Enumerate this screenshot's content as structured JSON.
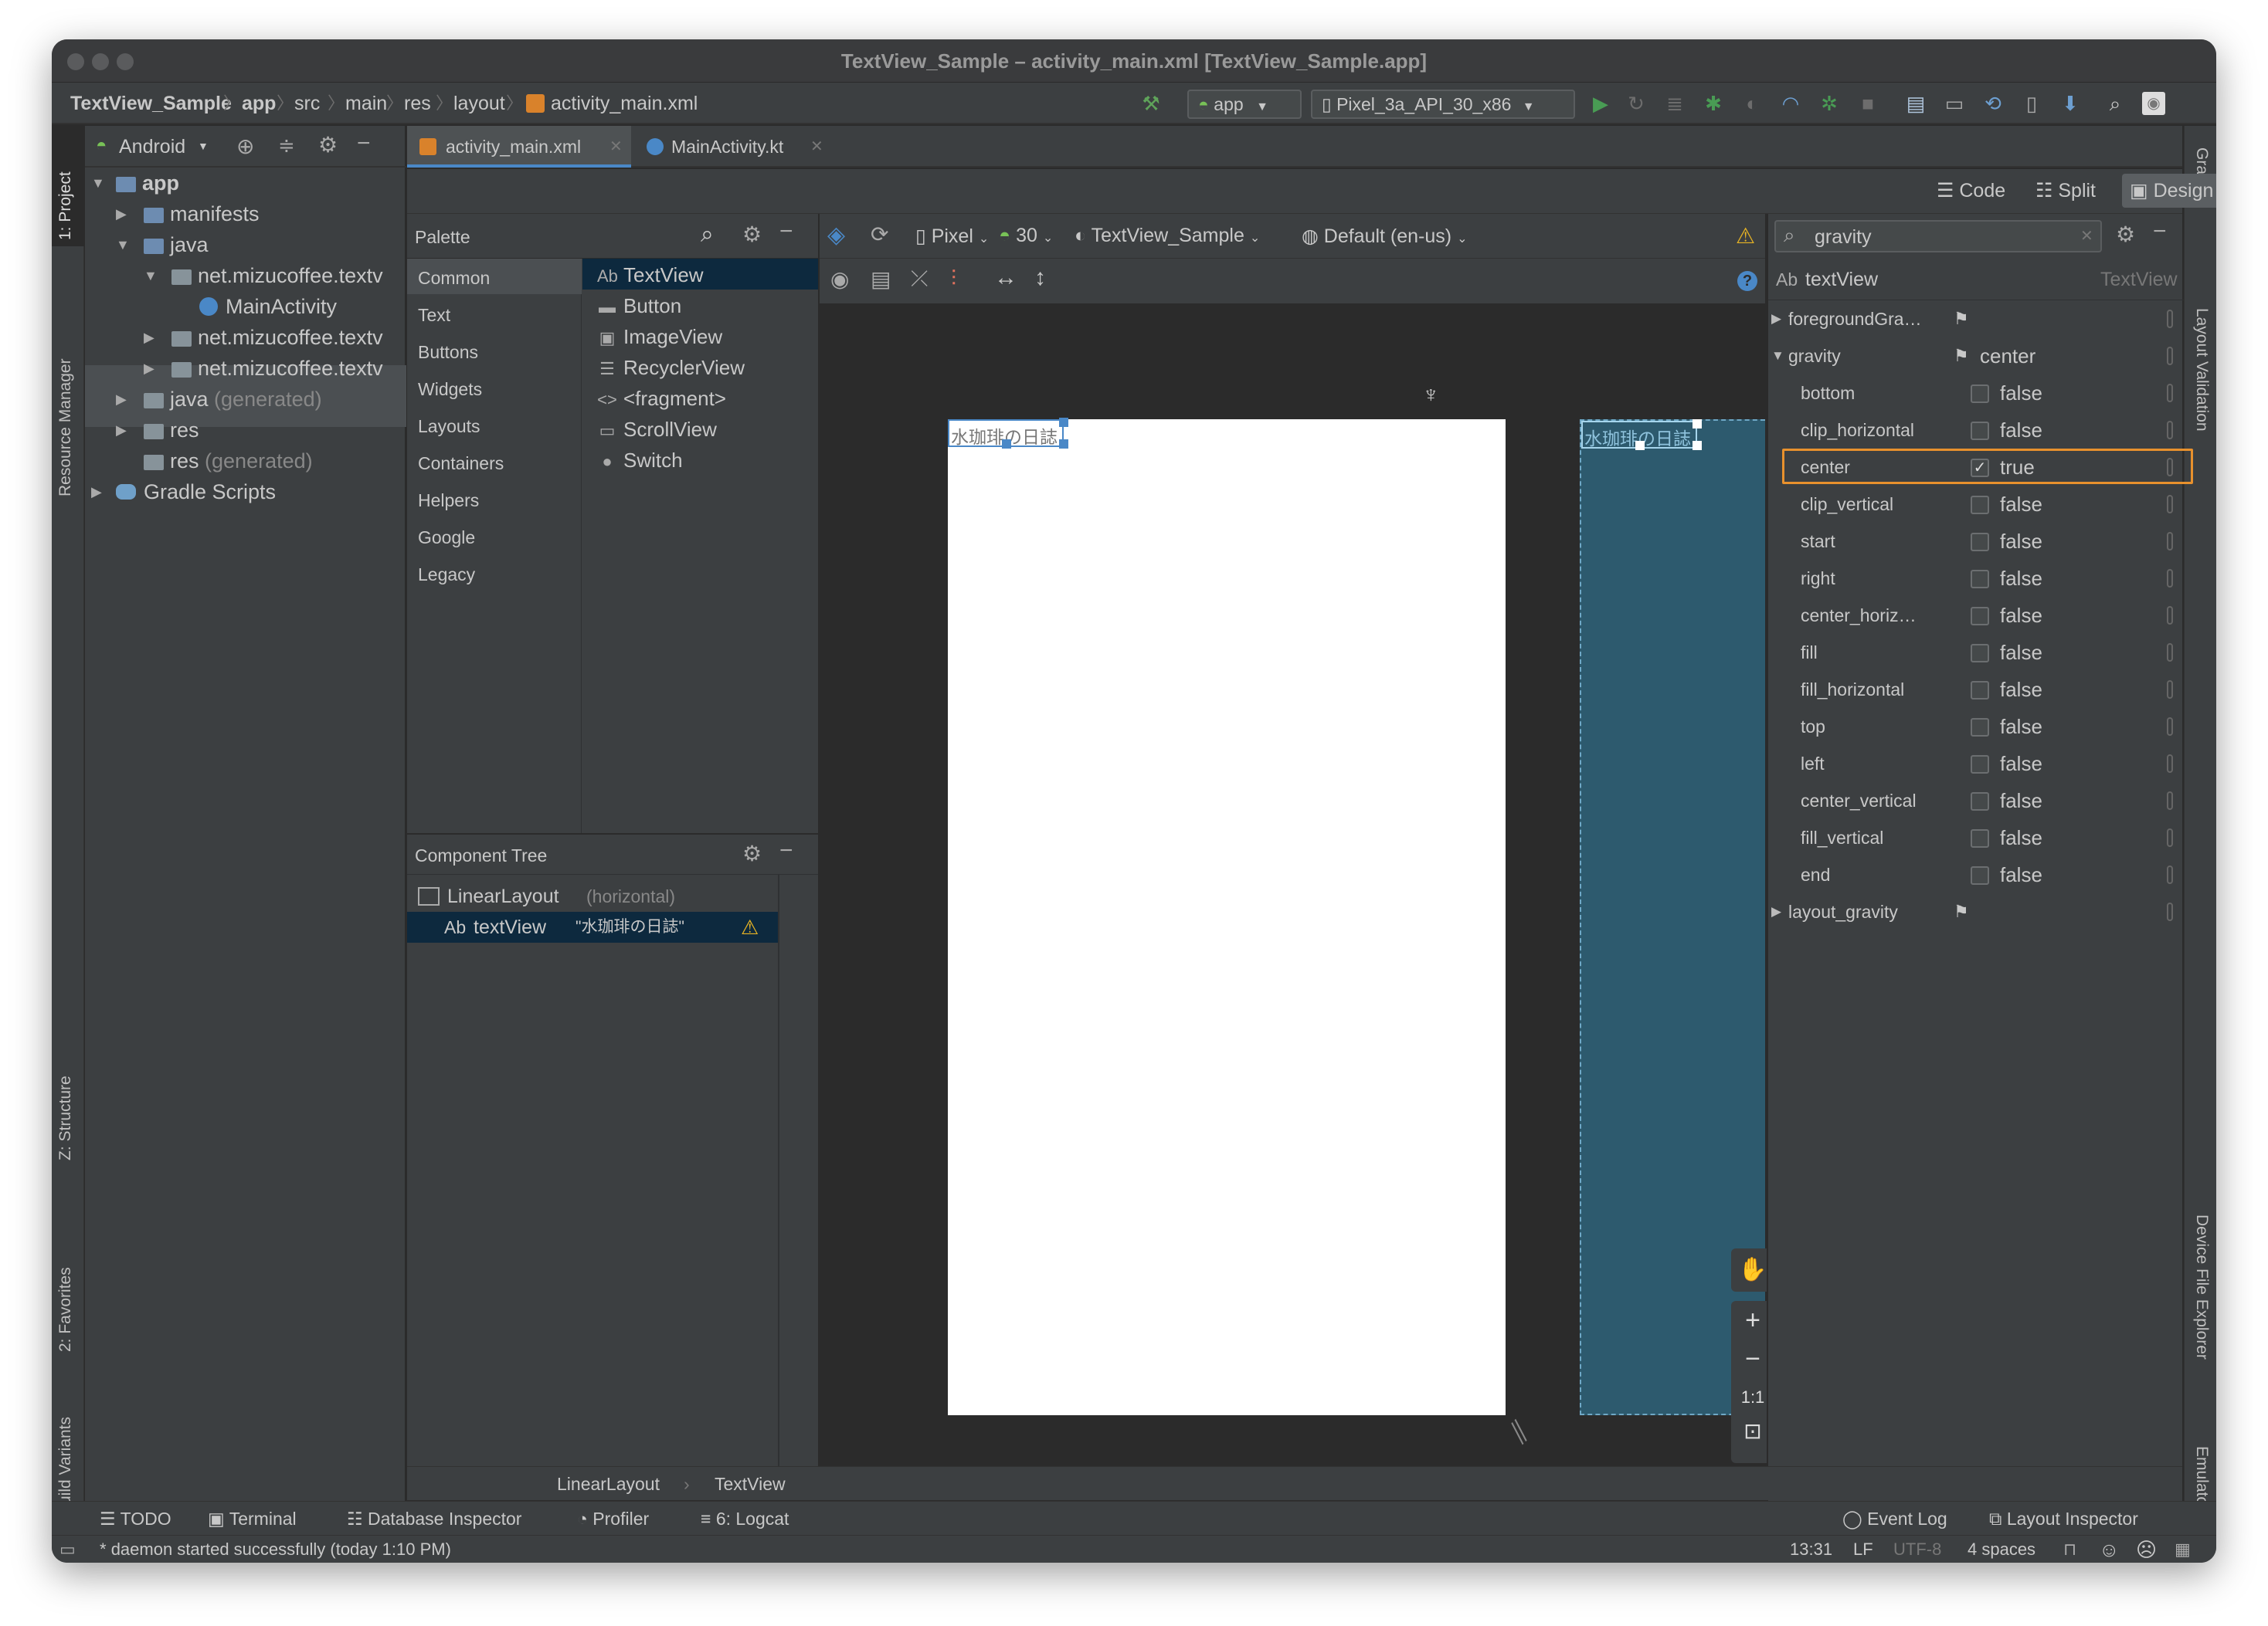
{
  "window": {
    "title": "TextView_Sample – activity_main.xml [TextView_Sample.app]"
  },
  "breadcrumb": [
    "TextView_Sample",
    "app",
    "src",
    "main",
    "res",
    "layout",
    "activity_main.xml"
  ],
  "run_config": "app",
  "device": "Pixel_3a_API_30_x86",
  "left_tools": {
    "project": "1: Project",
    "resource_manager": "Resource Manager",
    "structure": "Z: Structure",
    "favorites": "2: Favorites",
    "build_variants": "Build Variants"
  },
  "right_tools": {
    "gradle": "Gradle",
    "layout_validation": "Layout Validation",
    "device_file_explorer": "Device File Explorer",
    "emulator": "Emulator"
  },
  "project": {
    "view_mode": "Android",
    "tree": [
      {
        "label": "app",
        "bold": true
      },
      {
        "label": "manifests"
      },
      {
        "label": "java"
      },
      {
        "label": "net.mizucoffee.textv"
      },
      {
        "label": "MainActivity"
      },
      {
        "label": "net.mizucoffee.textv"
      },
      {
        "label": "net.mizucoffee.textv"
      },
      {
        "label": "java",
        "suffix": "(generated)"
      },
      {
        "label": "res"
      },
      {
        "label": "res",
        "suffix": "(generated)"
      },
      {
        "label": "Gradle Scripts"
      }
    ]
  },
  "editor_tabs": [
    {
      "label": "activity_main.xml"
    },
    {
      "label": "MainActivity.kt"
    }
  ],
  "view_modes": {
    "code": "Code",
    "split": "Split",
    "design": "Design"
  },
  "palette": {
    "title": "Palette",
    "categories": [
      "Common",
      "Text",
      "Buttons",
      "Widgets",
      "Layouts",
      "Containers",
      "Helpers",
      "Google",
      "Legacy"
    ],
    "items": [
      {
        "icon": "Ab",
        "label": "TextView"
      },
      {
        "icon": "▬",
        "label": "Button"
      },
      {
        "icon": "▣",
        "label": "ImageView"
      },
      {
        "icon": "☰",
        "label": "RecyclerView"
      },
      {
        "icon": "<>",
        "label": "<fragment>"
      },
      {
        "icon": "▭",
        "label": "ScrollView"
      },
      {
        "icon": "●",
        "label": "Switch"
      }
    ]
  },
  "design_toolbar": {
    "device": "Pixel",
    "api": "30",
    "theme": "TextView_Sample",
    "locale": "Default (en-us)"
  },
  "preview": {
    "text": "水珈琲の日誌"
  },
  "zoom_controls": {
    "fit": "1:1"
  },
  "component_tree": {
    "title": "Component Tree",
    "nodes": [
      {
        "label": "LinearLayout",
        "detail": "(horizontal)"
      },
      {
        "label": "textView",
        "detail": "\"水珈琲の日誌\"",
        "icon": "Ab"
      }
    ]
  },
  "attributes": {
    "search": "gravity",
    "component": "textView",
    "component_type": "TextView",
    "component_icon": "Ab",
    "rows": [
      {
        "name": "foregroundGra…",
        "value": "",
        "group": true,
        "expanded": false,
        "flag": true
      },
      {
        "name": "gravity",
        "value": "center",
        "group": true,
        "expanded": true,
        "flag": true
      },
      {
        "name": "bottom",
        "value": "false",
        "checked": false
      },
      {
        "name": "clip_horizontal",
        "value": "false",
        "checked": false
      },
      {
        "name": "center",
        "value": "true",
        "checked": true,
        "highlight": true
      },
      {
        "name": "clip_vertical",
        "value": "false",
        "checked": false
      },
      {
        "name": "start",
        "value": "false",
        "checked": false
      },
      {
        "name": "right",
        "value": "false",
        "checked": false
      },
      {
        "name": "center_horiz…",
        "value": "false",
        "checked": false
      },
      {
        "name": "fill",
        "value": "false",
        "checked": false
      },
      {
        "name": "fill_horizontal",
        "value": "false",
        "checked": false
      },
      {
        "name": "top",
        "value": "false",
        "checked": false
      },
      {
        "name": "left",
        "value": "false",
        "checked": false
      },
      {
        "name": "center_vertical",
        "value": "false",
        "checked": false
      },
      {
        "name": "fill_vertical",
        "value": "false",
        "checked": false
      },
      {
        "name": "end",
        "value": "false",
        "checked": false
      },
      {
        "name": "layout_gravity",
        "value": "",
        "group": true,
        "expanded": false,
        "flag": true
      }
    ],
    "highlight_color": "#e8912d"
  },
  "bottom_breadcrumb": [
    "LinearLayout",
    "TextView"
  ],
  "tool_windows": {
    "left": [
      {
        "icon": "☰",
        "label": "TODO"
      },
      {
        "icon": "▣",
        "label": "Terminal"
      },
      {
        "icon": "☷",
        "label": "Database Inspector"
      },
      {
        "icon": "◔",
        "label": "Profiler"
      },
      {
        "icon": "≡",
        "label": "6: Logcat"
      }
    ],
    "right": [
      {
        "icon": "◯",
        "label": "Event Log"
      },
      {
        "icon": "⧉",
        "label": "Layout Inspector"
      }
    ]
  },
  "status": {
    "message": "daemon started successfully (today 1:10 PM)",
    "position": "13:31",
    "line_sep": "LF",
    "encoding": "UTF-8",
    "indent": "4 spaces"
  },
  "colors": {
    "accent": "#4a88c7",
    "selection": "#2f65ca",
    "blueprint": "#2d5a6e",
    "warning": "#e8b424",
    "run": "#499c54"
  }
}
